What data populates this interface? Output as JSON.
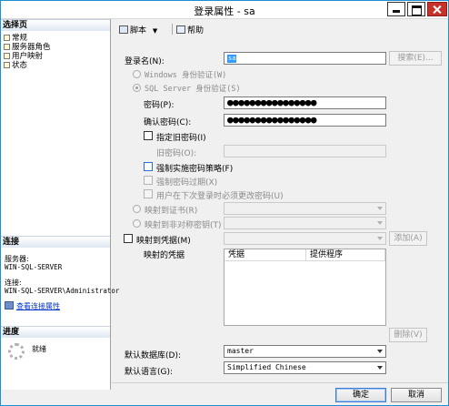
{
  "window": {
    "title": "登录属性 - sa"
  },
  "left_pane": {
    "select_page_header": "选择页",
    "pages": [
      {
        "label": "常规"
      },
      {
        "label": "服务器角色"
      },
      {
        "label": "用户映射"
      },
      {
        "label": "状态"
      }
    ],
    "connection_header": "连接",
    "server_label": "服务器:",
    "server_value": "WIN-SQL-SERVER",
    "connection_label": "连接:",
    "connection_value": "WIN-SQL-SERVER\\Administrator",
    "view_connection_link": "查看连接属性",
    "progress_header": "进度",
    "progress_status": "就绪"
  },
  "toolbar": {
    "script_label": "脚本",
    "help_label": "帮助"
  },
  "form": {
    "login_name_label": "登录名(N):",
    "login_name_value": "sa",
    "search_button": "搜索(E)...",
    "windows_auth_label": "Windows 身份验证(W)",
    "sql_auth_label": "SQL Server 身份验证(S)",
    "password_label": "密码(P):",
    "password_mask": "●●●●●●●●●●●●●●●●",
    "confirm_password_label": "确认密码(C):",
    "confirm_password_mask": "●●●●●●●●●●●●●●●●",
    "specify_old_password_label": "指定旧密码(I)",
    "old_password_label": "旧密码(O):",
    "enforce_policy_label": "强制实施密码策略(F)",
    "enforce_expiration_label": "强制密码过期(X)",
    "must_change_label": "用户在下次登录时必须更改密码(U)",
    "map_certificate_label": "映射到证书(R)",
    "map_asym_key_label": "映射到非对称密钥(T)",
    "map_credential_label": "映射到凭据(M)",
    "add_button": "添加(A)",
    "mapped_credentials_label": "映射的凭据",
    "grid_columns": [
      "凭据",
      "提供程序"
    ],
    "remove_button": "删除(V)",
    "default_database_label": "默认数据库(D):",
    "default_database_value": "master",
    "default_language_label": "默认语言(G):",
    "default_language_value": "Simplified Chinese"
  },
  "footer": {
    "ok_button": "确定",
    "cancel_button": "取消"
  },
  "colors": {
    "window_border": "#1e90d2",
    "close_button": "#c7312a",
    "selection": "#3399ff",
    "link": "#0033cc"
  }
}
